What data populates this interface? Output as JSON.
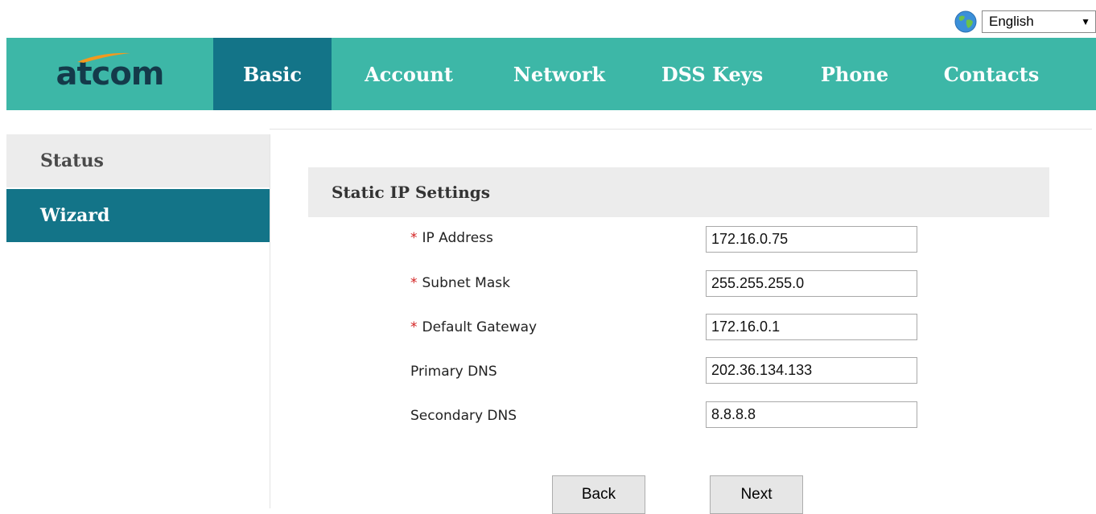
{
  "language": {
    "selected": "English",
    "icon": "globe-icon"
  },
  "brand": {
    "logo_text": "atcom"
  },
  "nav": [
    {
      "label": "Basic",
      "active": true
    },
    {
      "label": "Account"
    },
    {
      "label": "Network"
    },
    {
      "label": "DSS Keys"
    },
    {
      "label": "Phone"
    },
    {
      "label": "Contacts"
    }
  ],
  "sidebar": [
    {
      "label": "Status"
    },
    {
      "label": "Wizard",
      "active": true
    }
  ],
  "section": {
    "title": "Static IP Settings"
  },
  "fields": [
    {
      "label": "IP Address",
      "required": "*",
      "value": "172.16.0.75"
    },
    {
      "label": "Subnet Mask",
      "required": "*",
      "value": "255.255.255.0"
    },
    {
      "label": "Default Gateway",
      "required": "*",
      "value": "172.16.0.1"
    },
    {
      "label": "Primary DNS",
      "required": "",
      "value": "202.36.134.133"
    },
    {
      "label": "Secondary DNS",
      "required": "",
      "value": "8.8.8.8"
    }
  ],
  "buttons": {
    "back": "Back",
    "next": "Next"
  },
  "colors": {
    "nav_bg": "#3db7a7",
    "active_bg": "#137488",
    "required": "#d32020"
  }
}
